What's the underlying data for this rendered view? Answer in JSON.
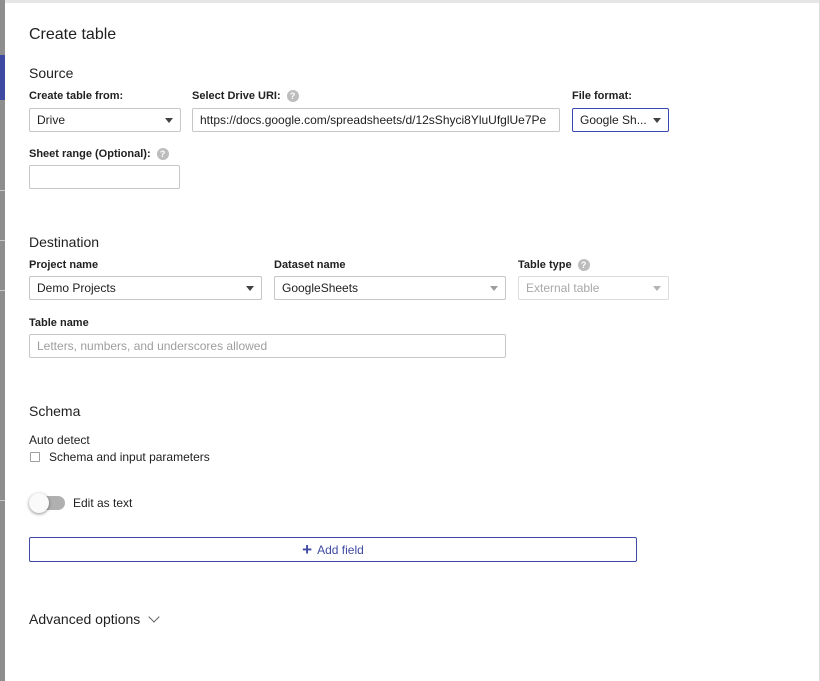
{
  "dialog": {
    "title": "Create table"
  },
  "source": {
    "heading": "Source",
    "create_from": {
      "label": "Create table from:",
      "value": "Drive"
    },
    "drive_uri": {
      "label": "Select Drive URI:",
      "value": "https://docs.google.com/spreadsheets/d/12sShyci8YluUfglUe7Pe"
    },
    "file_format": {
      "label": "File format:",
      "value": "Google Sh..."
    },
    "sheet_range": {
      "label": "Sheet range (Optional):",
      "value": ""
    }
  },
  "destination": {
    "heading": "Destination",
    "project": {
      "label": "Project name",
      "value": "Demo Projects"
    },
    "dataset": {
      "label": "Dataset name",
      "value": "GoogleSheets"
    },
    "table_type": {
      "label": "Table type",
      "value": "External table"
    },
    "table_name": {
      "label": "Table name",
      "placeholder": "Letters, numbers, and underscores allowed"
    }
  },
  "schema": {
    "heading": "Schema",
    "auto_detect_label": "Auto detect",
    "auto_detect_checkbox_label": "Schema and input parameters",
    "auto_detect_checked": false,
    "edit_as_text_label": "Edit as text",
    "edit_as_text_on": false,
    "add_field_label": "Add field"
  },
  "advanced": {
    "label": "Advanced options"
  },
  "icons": {
    "help": "help-icon",
    "dropdown": "caret-down-icon",
    "add": "plus-icon",
    "expand": "chevron-down-icon"
  },
  "colors": {
    "accent": "#3f4aa3",
    "border": "#c6c6c6",
    "help": "#bdbdbd"
  }
}
